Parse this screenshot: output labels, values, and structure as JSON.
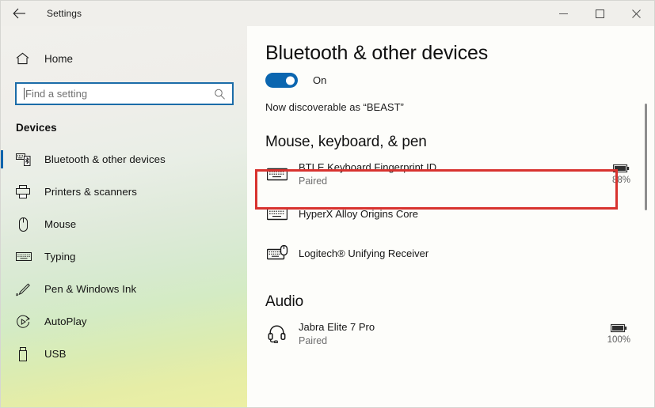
{
  "window": {
    "app_title": "Settings",
    "back_icon": "back-arrow-icon",
    "controls": {
      "minimize": "minimize-icon",
      "maximize": "maximize-icon",
      "close": "close-icon"
    }
  },
  "sidebar": {
    "home": {
      "label": "Home",
      "icon": "home-icon"
    },
    "search": {
      "placeholder": "Find a setting",
      "value": "",
      "icon": "search-icon"
    },
    "section_title": "Devices",
    "items": [
      {
        "label": "Bluetooth & other devices",
        "icon": "bluetooth-devices-icon",
        "selected": true
      },
      {
        "label": "Printers & scanners",
        "icon": "printer-icon",
        "selected": false
      },
      {
        "label": "Mouse",
        "icon": "mouse-icon",
        "selected": false
      },
      {
        "label": "Typing",
        "icon": "keyboard-icon",
        "selected": false
      },
      {
        "label": "Pen & Windows Ink",
        "icon": "pen-icon",
        "selected": false
      },
      {
        "label": "AutoPlay",
        "icon": "autoplay-icon",
        "selected": false
      },
      {
        "label": "USB",
        "icon": "usb-icon",
        "selected": false
      }
    ]
  },
  "main": {
    "page_title": "Bluetooth & other devices",
    "bluetooth_toggle": {
      "state": "On",
      "label": "On",
      "on": true,
      "accent": "#0b66b0"
    },
    "discoverable_text": "Now discoverable as “BEAST”",
    "groups": [
      {
        "title": "Mouse, keyboard, & pen",
        "devices": [
          {
            "name": "BTLE Keyboard Fingerprint ID",
            "status": "Paired",
            "icon": "keyboard-icon",
            "battery": "88%",
            "has_battery": true,
            "highlighted": true
          },
          {
            "name": "HyperX Alloy Origins Core",
            "status": "",
            "icon": "keyboard-icon",
            "battery": "",
            "has_battery": false,
            "highlighted": false
          },
          {
            "name": "Logitech® Unifying Receiver",
            "status": "",
            "icon": "keyboard-mouse-icon",
            "battery": "",
            "has_battery": false,
            "highlighted": false
          }
        ]
      },
      {
        "title": "Audio",
        "devices": [
          {
            "name": "Jabra Elite 7 Pro",
            "status": "Paired",
            "icon": "headset-icon",
            "battery": "100%",
            "has_battery": true,
            "highlighted": false
          }
        ]
      }
    ]
  },
  "annotation": {
    "color": "#d8332f",
    "target": "BTLE Keyboard Fingerprint ID"
  }
}
